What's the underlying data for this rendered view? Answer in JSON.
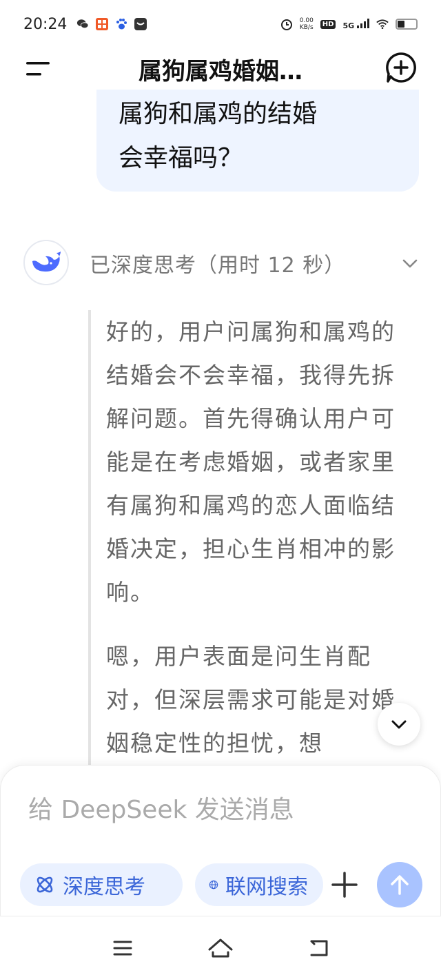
{
  "status_bar": {
    "time": "20:24",
    "net_speed_value": "0.00",
    "net_speed_unit": "KB/s",
    "hd": "HD",
    "signal": "5G",
    "left_icons": [
      "wechat-icon",
      "app-grid-icon",
      "baidu-paw-icon",
      "chat-notify-icon"
    ],
    "right_icons": [
      "alarm-icon",
      "wifi-icon",
      "battery-icon"
    ]
  },
  "header": {
    "title": "属狗属鸡婚姻…",
    "menu_icon": "menu-icon",
    "new_chat_icon": "new-chat-icon"
  },
  "chat": {
    "user_message": {
      "lines": [
        "属狗和属鸡的结婚",
        "会幸福吗？"
      ]
    },
    "assistant": {
      "avatar_icon": "deepseek-whale-icon",
      "thinking_label": "已深度思考（用时 12 秒）",
      "thinking_paragraphs": [
        "好的，用户问属狗和属鸡的结婚会不会幸福，我得先拆解问题。首先得确认用户可能是在考虑婚姻，或者家里有属狗和属鸡的恋人面临结婚决定，担心生肖相冲的影响。",
        "嗯，用户表面是问生肖配对，但深层需求可能是对婚姻稳定性的担忧，想"
      ]
    }
  },
  "composer": {
    "placeholder": "给 DeepSeek 发送消息",
    "deep_think_label": "深度思考",
    "web_search_label": "联网搜索",
    "accent_color": "#3b66d8",
    "send_color": "#a9c3ff"
  },
  "navbar": {
    "icons": [
      "nav-menu-icon",
      "nav-home-icon",
      "nav-back-icon"
    ]
  }
}
